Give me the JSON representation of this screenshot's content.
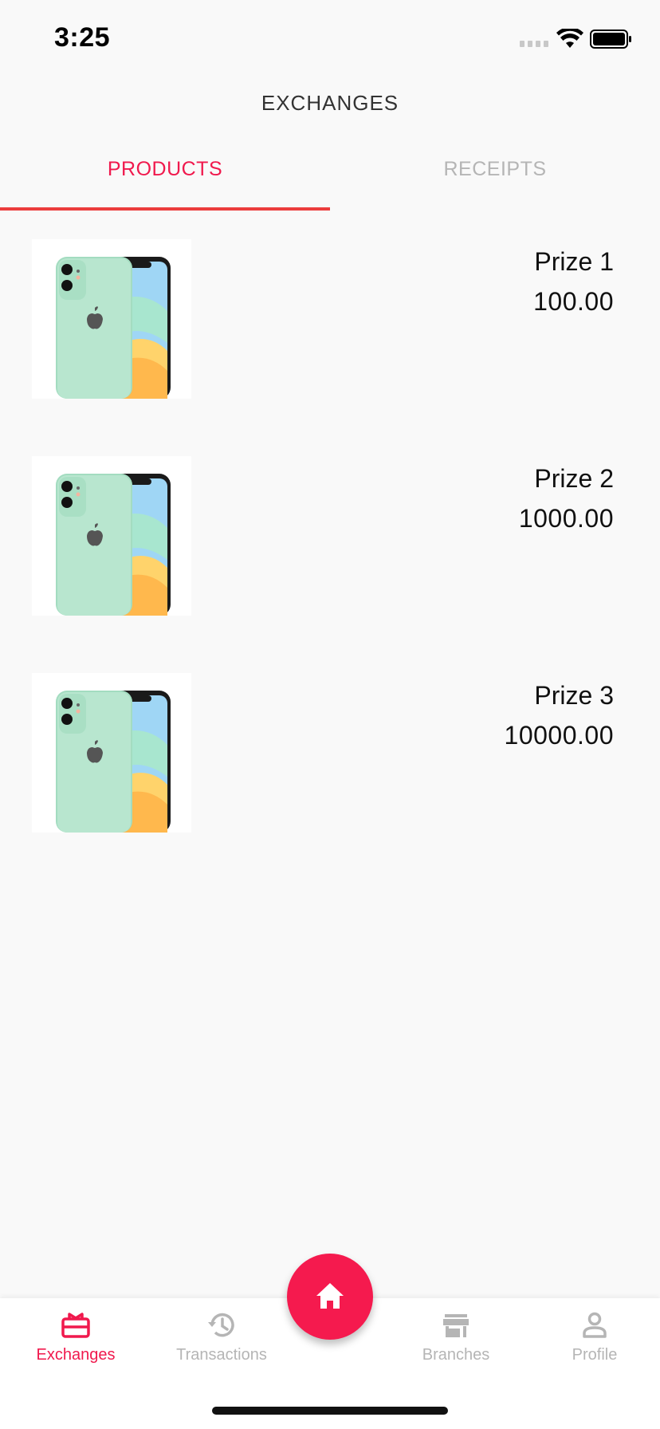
{
  "status_bar": {
    "time": "3:25"
  },
  "header": {
    "title": "EXCHANGES"
  },
  "tabs": [
    {
      "label": "PRODUCTS",
      "active": true
    },
    {
      "label": "RECEIPTS",
      "active": false
    }
  ],
  "products": [
    {
      "name": "Prize 1",
      "price": "100.00",
      "image": "phone-product-image"
    },
    {
      "name": "Prize 2",
      "price": "1000.00",
      "image": "phone-product-image"
    },
    {
      "name": "Prize 3",
      "price": "10000.00",
      "image": "phone-product-image"
    }
  ],
  "bottom_nav": {
    "items": [
      {
        "label": "Exchanges",
        "icon": "gift-icon",
        "active": true
      },
      {
        "label": "Transactions",
        "icon": "history-icon",
        "active": false
      },
      {
        "label": "Branches",
        "icon": "store-icon",
        "active": false
      },
      {
        "label": "Profile",
        "icon": "person-icon",
        "active": false
      }
    ],
    "fab": {
      "icon": "home-icon"
    }
  },
  "colors": {
    "accent": "#f0194d",
    "tab_indicator": "#ec3d3d",
    "inactive": "#b5b5b5",
    "background": "#f9f9f9"
  }
}
